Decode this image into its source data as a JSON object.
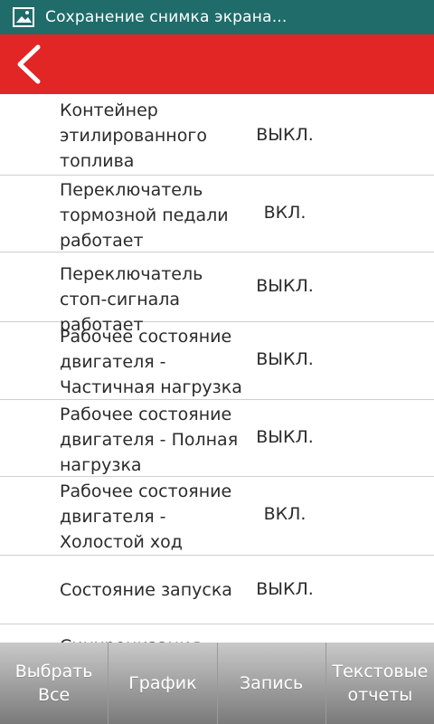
{
  "status_bar": {
    "icon": "image-icon",
    "text": "Сохранение снимка экрана..."
  },
  "toolbar": {
    "back_icon": "chevron-left-icon",
    "color": "#e22525"
  },
  "rows": [
    {
      "label": "Контейнер этилированного топлива",
      "value": "ВЫКЛ."
    },
    {
      "label": "Переключатель тормозной педали работает",
      "value": "ВКЛ."
    },
    {
      "label": "Переключатель стоп-сигнала работает",
      "value": "ВЫКЛ."
    },
    {
      "label": "Рабочее состояние двигателя - Частичная нагрузка",
      "value": "ВЫКЛ."
    },
    {
      "label": "Рабочее состояние двигателя - Полная нагрузка",
      "value": "ВЫКЛ."
    },
    {
      "label": "Рабочее состояние двигателя - Холостой ход",
      "value": "ВКЛ."
    },
    {
      "label": "Состояние запуска",
      "value": "ВЫКЛ."
    },
    {
      "label": "Синхронизация",
      "value": ""
    }
  ],
  "bottom_bar": {
    "select_all": "Выбрать Все",
    "graph": "График",
    "record": "Запись",
    "text_reports": "Текстовые отчеты"
  }
}
